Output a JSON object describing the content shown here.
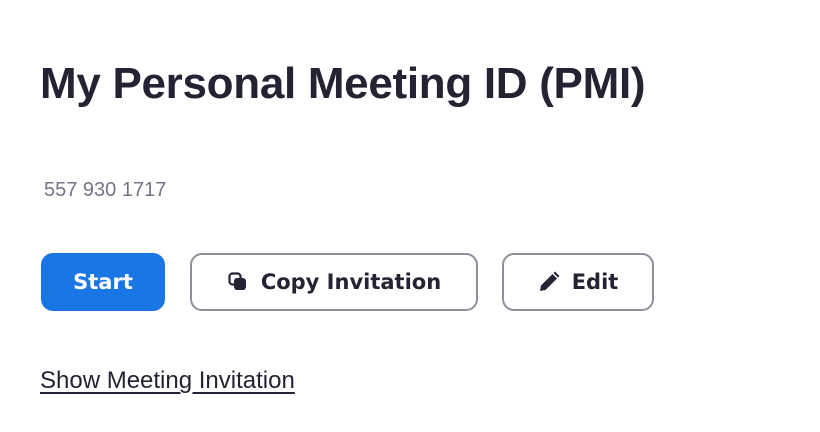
{
  "header": {
    "title": "My Personal Meeting ID (PMI)"
  },
  "meeting": {
    "id": "557 930 1717"
  },
  "actions": {
    "start_label": "Start",
    "copy_label": "Copy Invitation",
    "copy_icon": "copy-icon",
    "edit_label": "Edit",
    "edit_icon": "pencil-icon"
  },
  "links": {
    "show_invitation": "Show Meeting Invitation"
  },
  "colors": {
    "primary": "#1b76e5",
    "text": "#232333",
    "muted": "#747487",
    "border": "#8f8f99"
  }
}
